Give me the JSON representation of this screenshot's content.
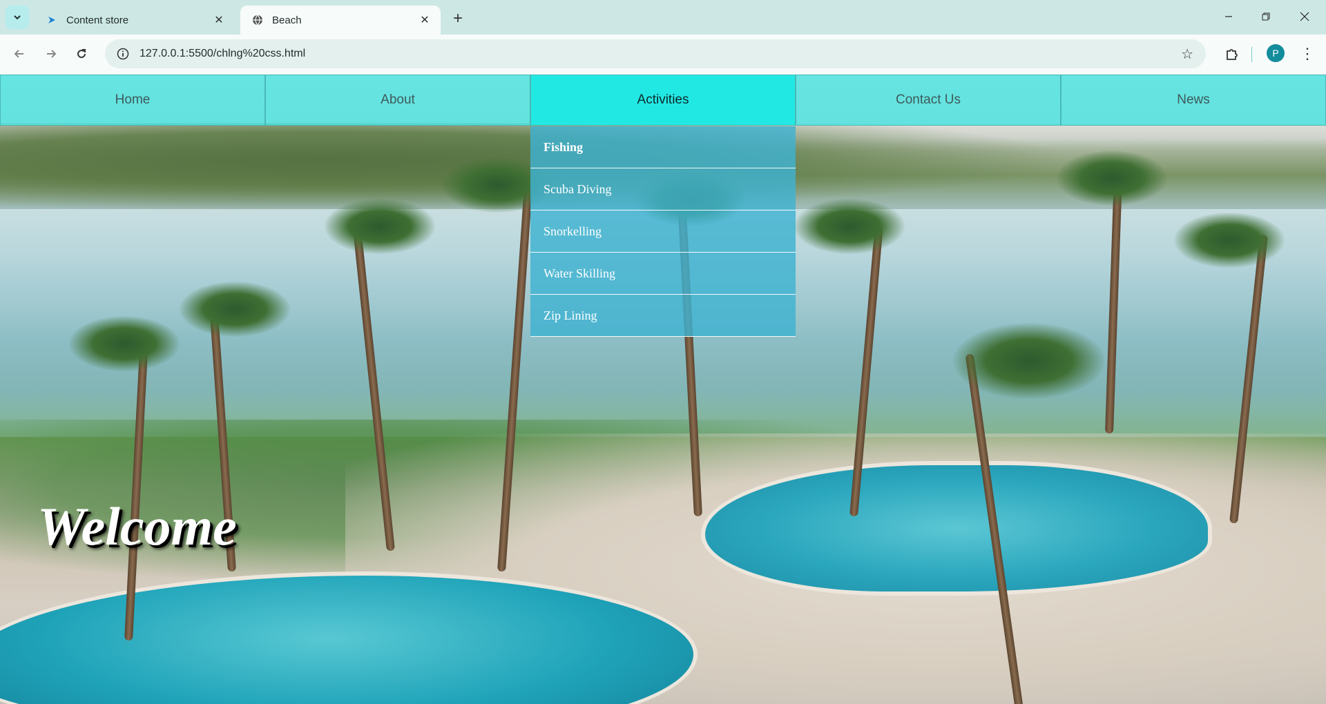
{
  "browser": {
    "tabs": [
      {
        "title": "Content store",
        "icon": "content-store-favicon",
        "active": false
      },
      {
        "title": "Beach",
        "icon": "globe-icon",
        "active": true
      }
    ],
    "url": "127.0.0.1:5500/chlng%20css.html",
    "profile_initial": "P"
  },
  "nav": {
    "items": [
      "Home",
      "About",
      "Activities",
      "Contact Us",
      "News"
    ],
    "active": "Activities"
  },
  "dropdown": {
    "items": [
      "Fishing",
      "Scuba Diving",
      "Snorkelling",
      "Water Skilling",
      "Zip Lining"
    ]
  },
  "hero": {
    "heading": "Welcome",
    "background": "beach resort photo with palm trees and pools"
  },
  "colors": {
    "nav_bg": "#4ee2e0",
    "nav_active": "#22e8e4",
    "dropdown_bg": "#3fb2d1"
  }
}
